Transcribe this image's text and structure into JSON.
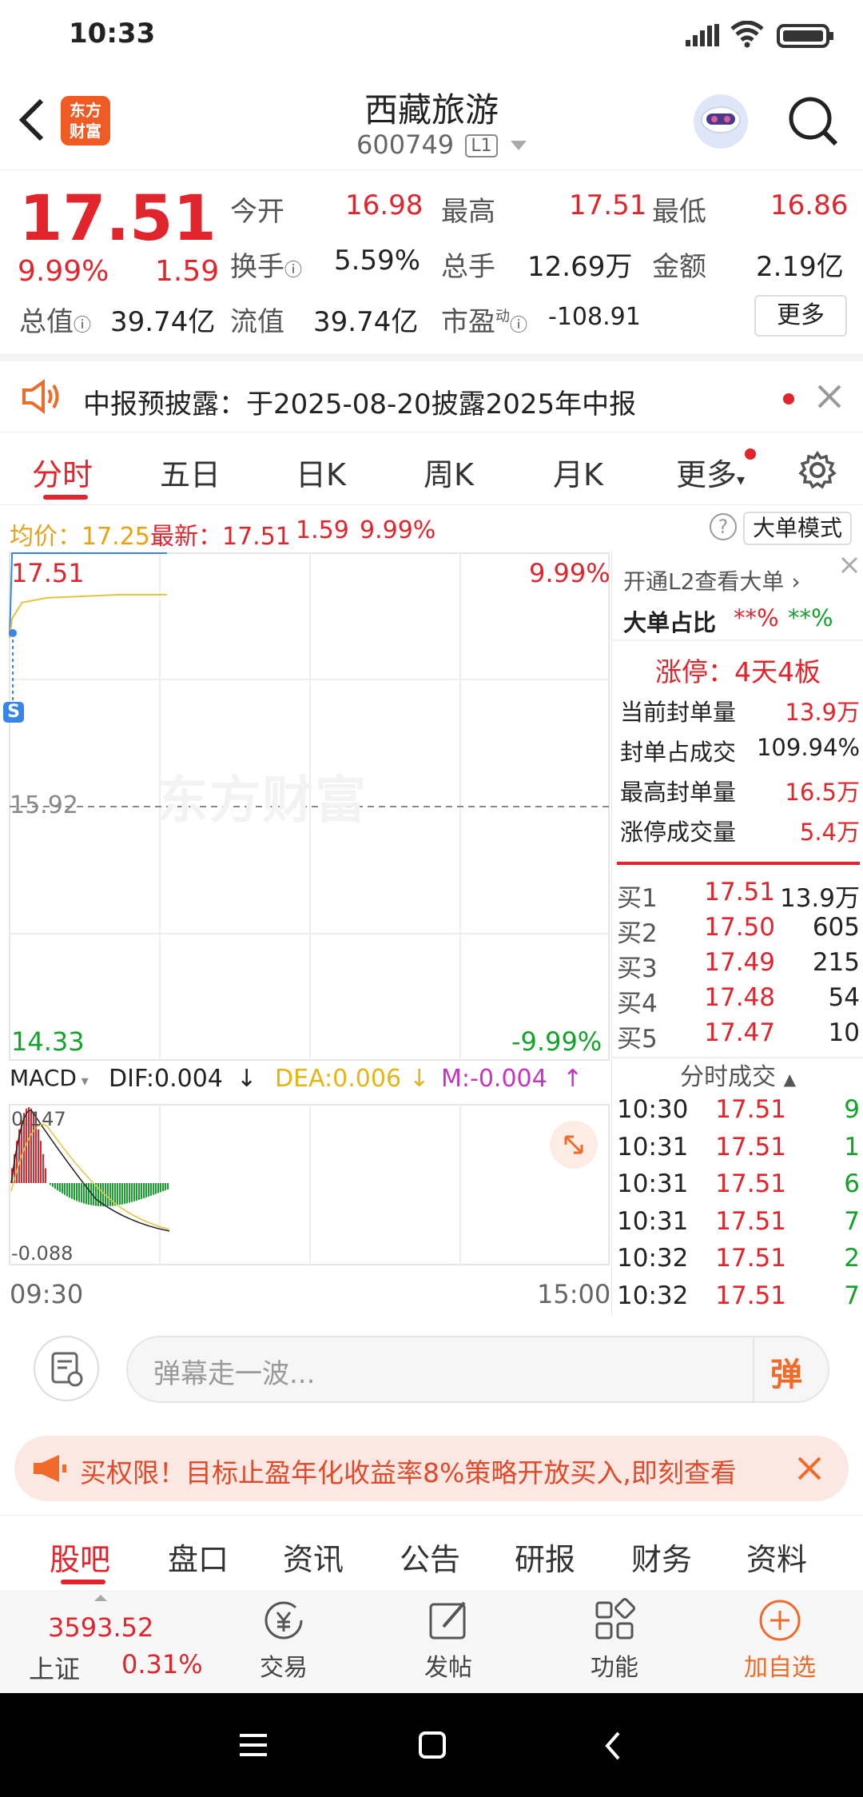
{
  "status": {
    "time": "10:33"
  },
  "header": {
    "title": "西藏旅游",
    "code": "600749",
    "level": "L1",
    "logo_text": "东方财富"
  },
  "quote": {
    "price": "17.51",
    "change_pct": "9.99%",
    "change": "1.59",
    "open_label": "今开",
    "open": "16.98",
    "high_label": "最高",
    "high": "17.51",
    "low_label": "最低",
    "low": "16.86",
    "turnover_label": "换手",
    "turnover": "5.59%",
    "volume_label": "总手",
    "volume": "12.69万",
    "amount_label": "金额",
    "amount": "2.19亿",
    "mktcap_label": "总值",
    "mktcap": "39.74亿",
    "float_label": "流值",
    "float": "39.74亿",
    "pe_label": "市盈",
    "pe_sup": "动",
    "pe": "-108.91",
    "more": "更多"
  },
  "notice": {
    "text": "中报预披露：于2025-08-20披露2025年中报"
  },
  "tabs": [
    "分时",
    "五日",
    "日K",
    "周K",
    "月K",
    "更多"
  ],
  "infobar": {
    "avg": "均价：17.25",
    "latest": "最新：17.51",
    "chg": "1.59",
    "pct": "9.99%",
    "mode": "大单模式"
  },
  "chart": {
    "top_price": "17.51",
    "top_pct": "9.99%",
    "mid_price": "15.92",
    "bot_price": "14.33",
    "bot_pct": "-9.99%",
    "macd_label": "MACD",
    "dif": "DIF:0.004",
    "dea": "DEA:0.006",
    "m": "M:-0.004",
    "macd_top": "0.147",
    "macd_bot": "-0.088",
    "time_start": "09:30",
    "time_end": "15:00",
    "watermark": "东方财富"
  },
  "chart_data": {
    "type": "line",
    "x": [
      "09:30",
      "09:31",
      "09:35",
      "09:45",
      "10:00",
      "10:15",
      "10:30",
      "10:33"
    ],
    "series": [
      {
        "name": "最新",
        "values": [
          16.98,
          17.51,
          17.51,
          17.51,
          17.51,
          17.51,
          17.51,
          17.51
        ]
      },
      {
        "name": "均价",
        "values": [
          16.98,
          17.1,
          17.2,
          17.23,
          17.24,
          17.25,
          17.25,
          17.25
        ]
      }
    ],
    "ylim": [
      14.33,
      17.51
    ]
  },
  "side": {
    "l2": "开通L2查看大单",
    "big_ratio_label": "大单占比",
    "big_ratio_a": "**%",
    "big_ratio_b": "**%",
    "limit": "涨停：4天4板",
    "rows": [
      {
        "label": "当前封单量",
        "value": "13.9万"
      },
      {
        "label": "封单占成交",
        "value": "109.94%"
      },
      {
        "label": "最高封单量",
        "value": "16.5万"
      },
      {
        "label": "涨停成交量",
        "value": "5.4万"
      }
    ],
    "bids": [
      {
        "label": "买1",
        "price": "17.51",
        "vol": "13.9万"
      },
      {
        "label": "买2",
        "price": "17.50",
        "vol": "605"
      },
      {
        "label": "买3",
        "price": "17.49",
        "vol": "215"
      },
      {
        "label": "买4",
        "price": "17.48",
        "vol": "54"
      },
      {
        "label": "买5",
        "price": "17.47",
        "vol": "10"
      }
    ],
    "ticks_title": "分时成交",
    "ticks": [
      {
        "t": "10:30",
        "p": "17.51",
        "v": "9"
      },
      {
        "t": "10:31",
        "p": "17.51",
        "v": "1"
      },
      {
        "t": "10:31",
        "p": "17.51",
        "v": "6"
      },
      {
        "t": "10:31",
        "p": "17.51",
        "v": "7"
      },
      {
        "t": "10:32",
        "p": "17.51",
        "v": "2"
      },
      {
        "t": "10:32",
        "p": "17.51",
        "v": "7"
      }
    ]
  },
  "barrage": {
    "placeholder": "弹幕走一波...",
    "btn": "弹"
  },
  "ad": {
    "text": "买权限！目标止盈年化收益率8%策略开放买入,即刻查看"
  },
  "subtabs": [
    "股吧",
    "盘口",
    "资讯",
    "公告",
    "研报",
    "财务",
    "资料"
  ],
  "dock": {
    "index_value": "3593.52",
    "index_name": "上证",
    "index_pct": "0.31%",
    "trade": "交易",
    "post": "发帖",
    "func": "功能",
    "add": "加自选"
  }
}
